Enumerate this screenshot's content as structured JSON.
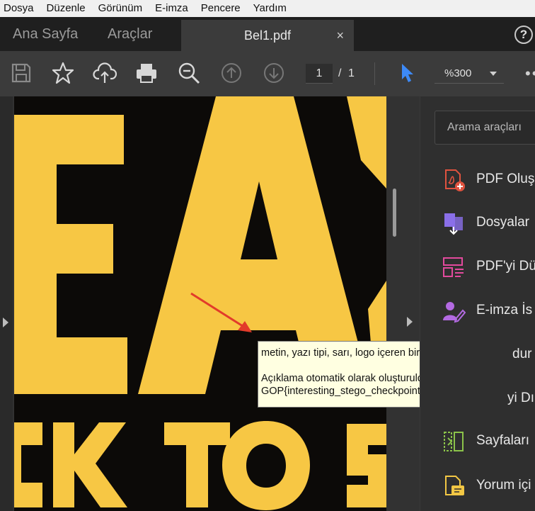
{
  "menu": [
    "Dosya",
    "Düzenle",
    "Görünüm",
    "E-imza",
    "Pencere",
    "Yardım"
  ],
  "tabs": {
    "home": "Ana Sayfa",
    "tools": "Araçlar",
    "document": "Bel1.pdf",
    "close": "×",
    "help": "?"
  },
  "toolbar": {
    "icons": [
      "save-icon",
      "star-icon",
      "cloud-upload-icon",
      "print-icon",
      "zoom-out-icon",
      "page-up-icon",
      "page-down-icon",
      "select-cursor-icon"
    ],
    "page_current": "1",
    "page_separator": "/",
    "page_total": "1",
    "zoom": "%300",
    "more": "••"
  },
  "document": {
    "image_text_top": "EA",
    "image_text_bottom": "CK TO S",
    "image_colors": {
      "background": "#0c0a08",
      "letters": "#f7c744",
      "arrow": "#e23b2a"
    }
  },
  "tooltip": {
    "line1": "metin, yazı tipi, sarı, logo içeren bir resim",
    "line2": "Açıklama otomatik olarak oluşturuldu.",
    "line3": "GOP{interesting_stego_checkpoint}"
  },
  "right_pane": {
    "search_label": "Arama araçları",
    "tools": [
      {
        "label": "PDF Oluş",
        "icon": "pdf-create-icon",
        "color": "#e0533f"
      },
      {
        "label": "Dosyalar",
        "icon": "combine-files-icon",
        "color": "#8a6fe8"
      },
      {
        "label": "PDF'yi Dü",
        "icon": "edit-pdf-icon",
        "color": "#e24a9d"
      },
      {
        "label": "E-imza İs",
        "icon": "e-sign-icon",
        "color": "#b36ae2"
      },
      {
        "label": "dur ve",
        "icon": "form-icon",
        "color": "#e0533f"
      },
      {
        "label": "yi Dı",
        "icon": "export-icon",
        "color": "#4fa7e8"
      },
      {
        "label": "Sayfaları",
        "icon": "organize-pages-icon",
        "color": "#8bc34a"
      },
      {
        "label": "Yorum içi",
        "icon": "comment-icon",
        "color": "#f2c744"
      }
    ]
  }
}
